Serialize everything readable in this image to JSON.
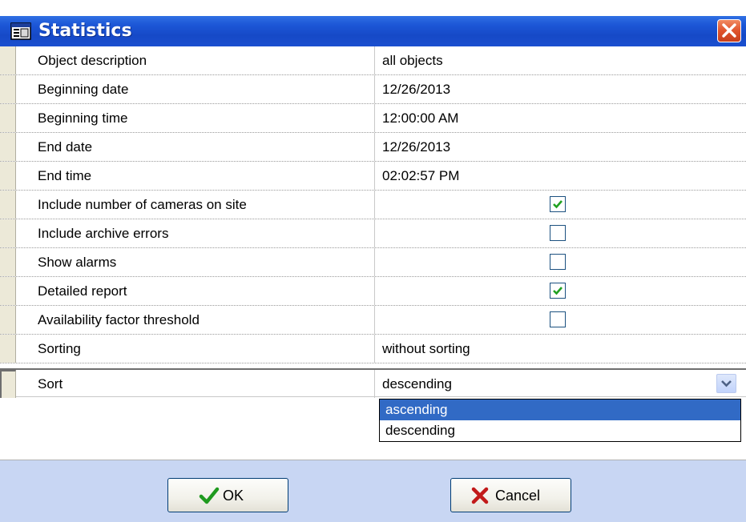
{
  "window": {
    "title": "Statistics"
  },
  "properties": [
    {
      "name": "Object description",
      "value": "all objects"
    },
    {
      "name": "Beginning date",
      "value": "12/26/2013"
    },
    {
      "name": "Beginning time",
      "value": "12:00:00 AM"
    },
    {
      "name": "End date",
      "value": "12/26/2013"
    },
    {
      "name": "End time",
      "value": "02:02:57 PM"
    },
    {
      "name": "Include number of cameras on site",
      "checked": true
    },
    {
      "name": "Include archive errors",
      "checked": false
    },
    {
      "name": "Show alarms",
      "checked": false
    },
    {
      "name": "Detailed report",
      "checked": true
    },
    {
      "name": "Availability factor threshold",
      "checked": false
    },
    {
      "name": "Sorting",
      "value": "without sorting"
    },
    {
      "name": "Sort",
      "value": "descending"
    }
  ],
  "sort_dropdown": {
    "options": [
      "ascending",
      "descending"
    ],
    "highlighted": "ascending"
  },
  "buttons": {
    "ok": "OK",
    "cancel": "Cancel"
  },
  "colors": {
    "title_bar": "#1649c7",
    "footer": "#c8d6f3",
    "selection": "#316ac5",
    "check_mark": "#21a121"
  },
  "icons": {
    "title": "window-icon",
    "close": "close-icon",
    "ok": "checkmark-icon",
    "cancel": "x-icon",
    "dropdown": "chevron-down-icon"
  }
}
